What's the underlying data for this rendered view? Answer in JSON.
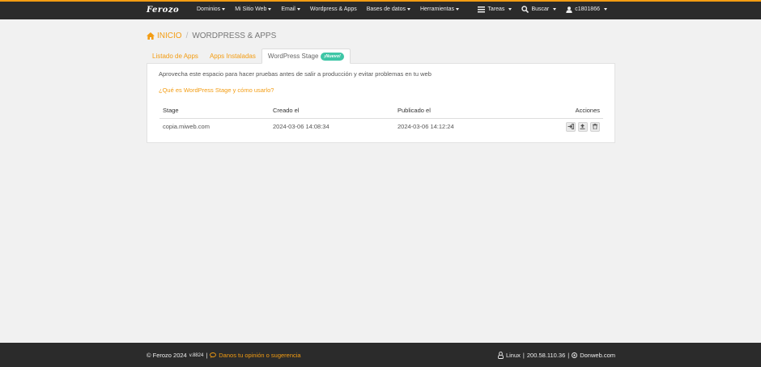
{
  "topbar": {
    "logo": "Ferozo",
    "nav": [
      {
        "label": "Dominios",
        "caret": true
      },
      {
        "label": "Mi Sitio Web",
        "caret": true
      },
      {
        "label": "Email",
        "caret": true
      },
      {
        "label": "Wordpress & Apps",
        "caret": false
      },
      {
        "label": "Bases de datos",
        "caret": true
      },
      {
        "label": "Herramientas",
        "caret": true
      }
    ],
    "tasks_label": "Tareas",
    "search_label": "Buscar",
    "user_label": "c1801866"
  },
  "breadcrumb": {
    "home": "INICIO",
    "separator": "/",
    "current": "WORDPRESS & APPS"
  },
  "tabs": [
    {
      "label": "Listado de Apps",
      "active": false
    },
    {
      "label": "Apps Instaladas",
      "active": false
    },
    {
      "label": "WordPress Stage",
      "active": true,
      "badge": "¡Nuevo!"
    }
  ],
  "panel": {
    "description": "Aprovecha este espacio para hacer pruebas antes de salir a producción y evitar problemas en tu web",
    "help_link": "¿Qué es WordPress Stage y cómo usarlo?",
    "table": {
      "headers": [
        "Stage",
        "Creado el",
        "Publicado el",
        "Acciones"
      ],
      "rows": [
        {
          "stage": "copia.miweb.com",
          "created": "2024-03-06 14:08:34",
          "published": "2024-03-06 14:12:24"
        }
      ]
    }
  },
  "footer": {
    "copyright": "© Ferozo 2024",
    "version": "v.8824",
    "pipe": "|",
    "feedback": "Danos tu opinión o sugerencia",
    "os": "Linux",
    "ip": "200.58.110.36",
    "brand": "Donweb.com"
  },
  "colors": {
    "accent": "#f39c12",
    "topbar_bg": "#2b2b2b",
    "badge_bg": "#3ec6a6"
  }
}
